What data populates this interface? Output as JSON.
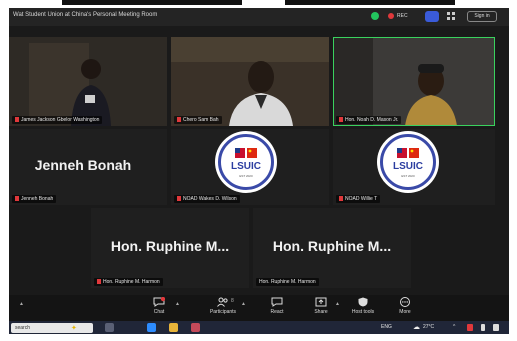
{
  "window": {
    "title": "Wat Student Union at China's Personal Meeting Room",
    "recording_label": "REC",
    "sign_in_label": "Sign in"
  },
  "participants": [
    {
      "name": "James Jackson Gbelor Washington",
      "kind": "video"
    },
    {
      "name": "Chero Sam Bah",
      "kind": "video"
    },
    {
      "name": "Hon. Noah D. Mason Jr.",
      "kind": "video"
    },
    {
      "name": "Jenneh Bonah",
      "kind": "name",
      "display": "Jenneh Bonah"
    },
    {
      "name": "NOAD Wakes D. Wilson",
      "kind": "logo"
    },
    {
      "name": "NOAD Willie T",
      "kind": "logo"
    },
    {
      "name": "Hon. Ruphine M. Harmon",
      "kind": "name",
      "display": "Hon. Ruphine M..."
    },
    {
      "name": "Hon. Ruphine M. Harmon",
      "kind": "name",
      "display": "Hon. Ruphine M..."
    }
  ],
  "logo": {
    "text": "LSUIC",
    "sub": "EST 2020"
  },
  "toolbar": {
    "items": [
      {
        "label": "Chat",
        "icon": "chat-icon"
      },
      {
        "label": "Participants",
        "icon": "participants-icon",
        "count": "8"
      },
      {
        "label": "React",
        "icon": "react-icon"
      },
      {
        "label": "Share",
        "icon": "share-icon"
      },
      {
        "label": "Host tools",
        "icon": "host-tools-icon"
      },
      {
        "label": "More",
        "icon": "more-icon"
      }
    ]
  },
  "taskbar": {
    "search_placeholder": "search",
    "lang": "ENG",
    "temperature": "27°C"
  },
  "colors": {
    "active_speaker": "#3ad25e",
    "mute_red": "#e0383b",
    "accent_blue": "#3a5bd9"
  }
}
